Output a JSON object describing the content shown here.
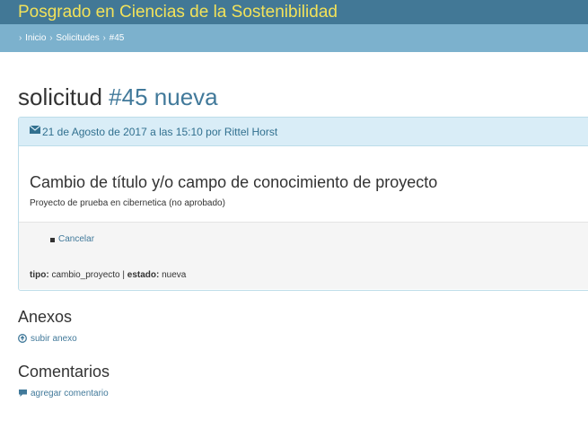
{
  "site": {
    "title": "Posgrado en Ciencias de la Sostenibilidad"
  },
  "breadcrumb": {
    "items": [
      "Inicio",
      "Solicitudes",
      "#45"
    ]
  },
  "page": {
    "title_prefix": "solicitud",
    "title_highlight": "#45 nueva"
  },
  "request": {
    "meta": "21 de Agosto de 2017 a las 15:10 por Rittel Horst",
    "title": "Cambio de título y/o campo de conocimiento de proyecto",
    "description": "Proyecto de prueba en cibernetica (no aprobado)",
    "actions": [
      "Cancelar"
    ],
    "footer": {
      "tipo_label": "tipo:",
      "tipo_value": "cambio_proyecto",
      "separator": "|",
      "estado_label": "estado:",
      "estado_value": "nueva"
    }
  },
  "attachments": {
    "title": "Anexos",
    "upload_label": "subir anexo"
  },
  "comments": {
    "title": "Comentarios",
    "add_label": "agregar comentario"
  },
  "icons": {
    "meta": "envelope-icon",
    "upload": "circle-arrow-up-icon",
    "comment": "comment-icon"
  },
  "colors": {
    "topbar": "#427896",
    "site_title": "#f2e25a",
    "breadcrumb_bar": "#7cb1cd",
    "link": "#41799a",
    "panel_header": "#d9edf7"
  }
}
